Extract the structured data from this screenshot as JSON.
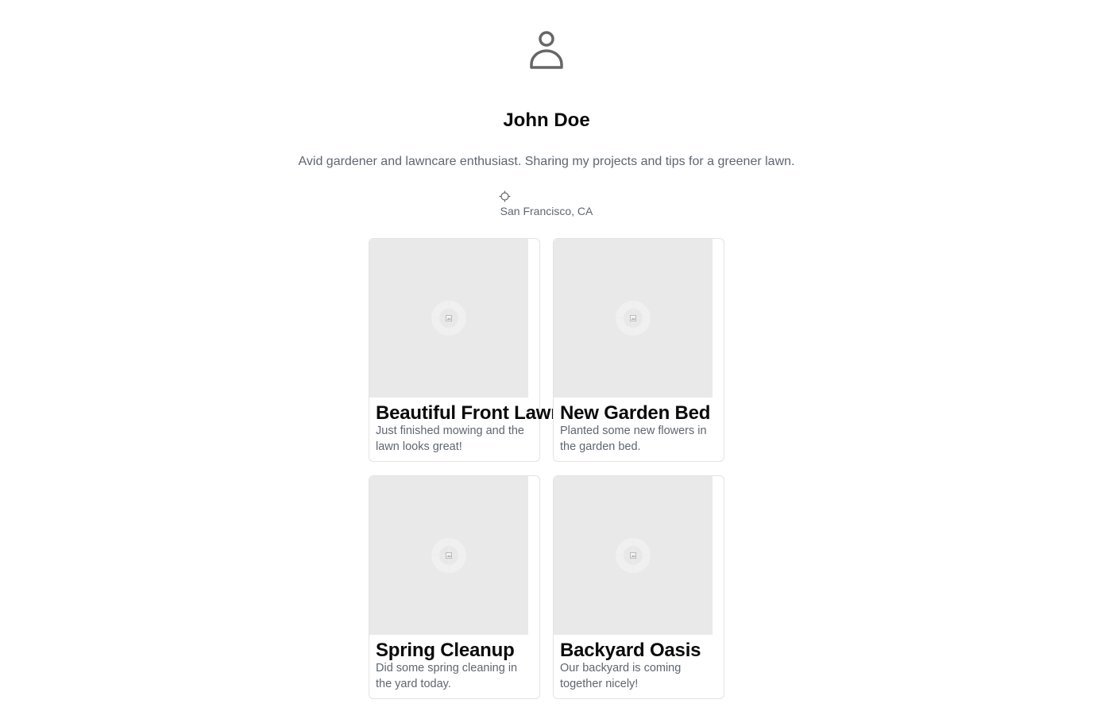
{
  "profile": {
    "avatar_icon": "user-icon",
    "name": "John Doe",
    "bio": "Avid gardener and lawncare enthusiast. Sharing my projects and tips for a greener lawn.",
    "location_icon": "crosshair-icon",
    "location": "San Francisco, CA"
  },
  "posts": [
    {
      "image_icon": "image-placeholder-icon",
      "title": "Beautiful Front Lawn",
      "description": "Just finished mowing and the lawn looks great!"
    },
    {
      "image_icon": "image-placeholder-icon",
      "title": "New Garden Bed",
      "description": "Planted some new flowers in the garden bed."
    },
    {
      "image_icon": "image-placeholder-icon",
      "title": "Spring Cleanup",
      "description": "Did some spring cleaning in the yard today."
    },
    {
      "image_icon": "image-placeholder-icon",
      "title": "Backyard Oasis",
      "description": "Our backyard is coming together nicely!"
    }
  ],
  "colors": {
    "text_primary": "#0a0a0a",
    "text_muted": "#5f6670",
    "card_border": "#e3e3e3",
    "thumb_background": "#e9e9e9",
    "icon": "#666666"
  }
}
